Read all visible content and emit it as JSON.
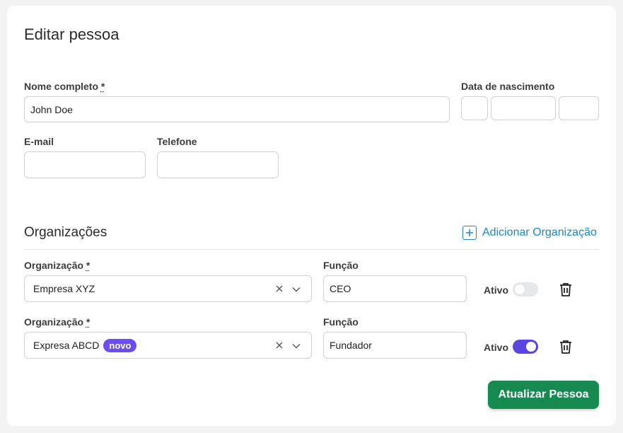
{
  "page": {
    "title": "Editar pessoa"
  },
  "form": {
    "name_label": "Nome completo",
    "required_mark": "*",
    "name_value": "John Doe",
    "birth_label": "Data de nascimento",
    "email_label": "E-mail",
    "email_value": "",
    "phone_label": "Telefone",
    "phone_value": ""
  },
  "orgs": {
    "section_title": "Organizações",
    "add_label": "Adicionar Organização",
    "org_label": "Organização",
    "role_label": "Função",
    "active_label": "Ativo",
    "rows": [
      {
        "org": "Empresa XYZ",
        "badge": "",
        "role": "CEO",
        "active": false
      },
      {
        "org": "Expresa ABCD",
        "badge": "novo",
        "role": "Fundador",
        "active": true
      }
    ]
  },
  "actions": {
    "submit_label": "Atualizar Pessoa"
  },
  "colors": {
    "accent": "#5b45e0",
    "link": "#1a88c9",
    "primary": "#178a52"
  },
  "icons": [
    "plus-icon",
    "clear-icon",
    "chevron-down-icon",
    "trash-icon"
  ]
}
